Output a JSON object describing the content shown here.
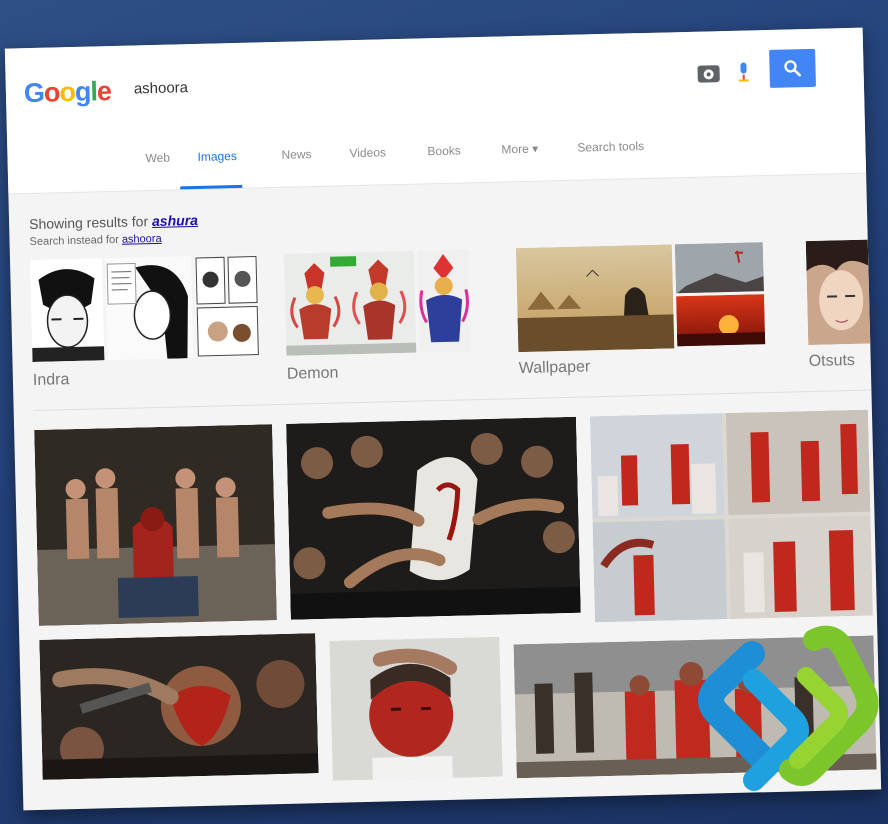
{
  "search": {
    "logo": [
      "G",
      "o",
      "o",
      "g",
      "l",
      "e"
    ],
    "query": "ashoora"
  },
  "tabs": [
    {
      "label": "Web"
    },
    {
      "label": "Images"
    },
    {
      "label": "News"
    },
    {
      "label": "Videos"
    },
    {
      "label": "Books"
    },
    {
      "label": "More ▾"
    },
    {
      "label": "Search tools"
    }
  ],
  "spelling": {
    "showing_prefix": "Showing results for ",
    "corrected": "ashura",
    "instead_prefix": "Search instead for ",
    "original": "ashoora"
  },
  "clusters": [
    {
      "label": "Indra"
    },
    {
      "label": "Demon"
    },
    {
      "label": "Wallpaper"
    },
    {
      "label": "Otsuts"
    }
  ],
  "colors": {
    "accent": "#4285f4",
    "link": "#1a0dab",
    "active_tab": "#1a73e8"
  }
}
